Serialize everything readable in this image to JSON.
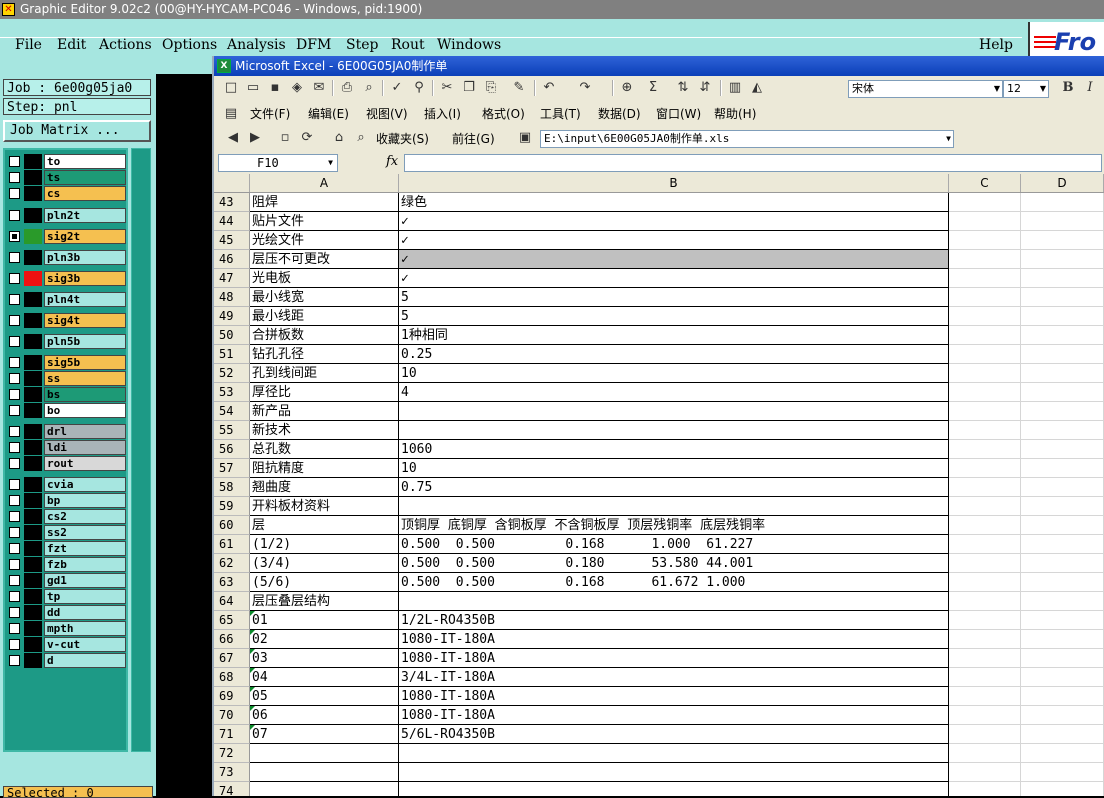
{
  "genesis": {
    "title": "Graphic Editor 9.02c2 (00@HY-HYCAM-PC046 - Windows, pid:1900)",
    "menu": [
      "File",
      "Edit",
      "Actions",
      "Options",
      "Analysis",
      "DFM",
      "Step",
      "Rout",
      "Windows"
    ],
    "help": "Help",
    "logo_text": "Fro",
    "job": "Job : 6e00g05ja0",
    "step": "Step: pnl",
    "job_matrix": "Job Matrix ...",
    "selected": "Selected : 0",
    "layers": [
      {
        "name": "to",
        "color": "#ffffff",
        "checked": false
      },
      {
        "name": "ts",
        "color": "#1d9a76",
        "checked": false
      },
      {
        "name": "cs",
        "color": "#f5c050",
        "checked": false
      },
      {
        "name": "pln2t",
        "color": "#a6e6e0",
        "checked": false
      },
      {
        "name": "sig2t",
        "color": "#f5c050",
        "checked": true,
        "swatch": "#2a9a2a"
      },
      {
        "name": "pln3b",
        "color": "#a6e6e0",
        "checked": false
      },
      {
        "name": "sig3b",
        "color": "#f5c050",
        "checked": false,
        "swatch": "#ee1111"
      },
      {
        "name": "pln4t",
        "color": "#a6e6e0",
        "checked": false
      },
      {
        "name": "sig4t",
        "color": "#f5c050",
        "checked": false
      },
      {
        "name": "pln5b",
        "color": "#a6e6e0",
        "checked": false
      },
      {
        "name": "sig5b",
        "color": "#f5c050",
        "checked": false
      },
      {
        "name": "ss",
        "color": "#f5c050",
        "checked": false
      },
      {
        "name": "bs",
        "color": "#1d9a76",
        "checked": false
      },
      {
        "name": "bo",
        "color": "#ffffff",
        "checked": false
      },
      {
        "name": "drl",
        "color": "#a9b4b8",
        "checked": false
      },
      {
        "name": "ldi",
        "color": "#a9b4b8",
        "checked": false
      },
      {
        "name": "rout",
        "color": "#d8d8d8",
        "checked": false
      },
      {
        "name": "cvia",
        "color": "#a6e6e0",
        "checked": false
      },
      {
        "name": "bp",
        "color": "#a6e6e0",
        "checked": false
      },
      {
        "name": "cs2",
        "color": "#a6e6e0",
        "checked": false
      },
      {
        "name": "ss2",
        "color": "#a6e6e0",
        "checked": false
      },
      {
        "name": "fzt",
        "color": "#a6e6e0",
        "checked": false
      },
      {
        "name": "fzb",
        "color": "#a6e6e0",
        "checked": false
      },
      {
        "name": "gd1",
        "color": "#a6e6e0",
        "checked": false
      },
      {
        "name": "tp",
        "color": "#a6e6e0",
        "checked": false
      },
      {
        "name": "dd",
        "color": "#a6e6e0",
        "checked": false
      },
      {
        "name": "mpth",
        "color": "#a6e6e0",
        "checked": false
      },
      {
        "name": "v-cut",
        "color": "#a6e6e0",
        "checked": false
      },
      {
        "name": "d",
        "color": "#a6e6e0",
        "checked": false
      }
    ]
  },
  "excel": {
    "title": "Microsoft Excel - 6E00G05JA0制作单",
    "font_name": "宋体",
    "font_size": "12",
    "menu": [
      "文件(F)",
      "编辑(E)",
      "视图(V)",
      "插入(I)",
      "格式(O)",
      "工具(T)",
      "数据(D)",
      "窗口(W)",
      "帮助(H)"
    ],
    "favorites": "收藏夹(S)",
    "goto": "前往(G)",
    "address": "E:\\input\\6E00G05JA0制作单.xls",
    "name_box": "F10",
    "fx": "fx",
    "columns": [
      "A",
      "B",
      "C",
      "D"
    ],
    "rows": [
      {
        "n": "43",
        "a": "阻焊",
        "b": "绿色"
      },
      {
        "n": "44",
        "a": "贴片文件",
        "b": "✓"
      },
      {
        "n": "45",
        "a": "光绘文件",
        "b": "✓"
      },
      {
        "n": "46",
        "a": "层压不可更改",
        "b": "✓",
        "hl": true
      },
      {
        "n": "47",
        "a": "光电板",
        "b": "✓"
      },
      {
        "n": "48",
        "a": "最小线宽",
        "b": "5"
      },
      {
        "n": "49",
        "a": "最小线距",
        "b": "5"
      },
      {
        "n": "50",
        "a": "合拼板数",
        "b": "1种相同"
      },
      {
        "n": "51",
        "a": "钻孔孔径",
        "b": "0.25"
      },
      {
        "n": "52",
        "a": "孔到线间距",
        "b": "10"
      },
      {
        "n": "53",
        "a": "厚径比",
        "b": "4"
      },
      {
        "n": "54",
        "a": "新产品",
        "b": ""
      },
      {
        "n": "55",
        "a": "新技术",
        "b": ""
      },
      {
        "n": "56",
        "a": "总孔数",
        "b": "1060"
      },
      {
        "n": "57",
        "a": "阻抗精度",
        "b": "10"
      },
      {
        "n": "58",
        "a": "翘曲度",
        "b": "0.75"
      },
      {
        "n": "59",
        "a": "开料板材资料",
        "b": ""
      },
      {
        "n": "60",
        "a": "层",
        "b": "顶铜厚 底铜厚 含铜板厚 不含铜板厚 顶层残铜率 底层残铜率"
      },
      {
        "n": "61",
        "a": "(1/2)",
        "b": "0.500  0.500         0.168      1.000  61.227"
      },
      {
        "n": "62",
        "a": "(3/4)",
        "b": "0.500  0.500         0.180      53.580 44.001"
      },
      {
        "n": "63",
        "a": "(5/6)",
        "b": "0.500  0.500         0.168      61.672 1.000"
      },
      {
        "n": "64",
        "a": "层压叠层结构",
        "b": ""
      },
      {
        "n": "65",
        "a": "01",
        "b": "1/2L-RO4350B",
        "tri": true
      },
      {
        "n": "66",
        "a": "02",
        "b": "1080-IT-180A",
        "tri": true
      },
      {
        "n": "67",
        "a": "03",
        "b": "1080-IT-180A",
        "tri": true
      },
      {
        "n": "68",
        "a": "04",
        "b": "3/4L-IT-180A",
        "tri": true
      },
      {
        "n": "69",
        "a": "05",
        "b": "1080-IT-180A",
        "tri": true
      },
      {
        "n": "70",
        "a": "06",
        "b": "1080-IT-180A",
        "tri": true
      },
      {
        "n": "71",
        "a": "07",
        "b": "5/6L-RO4350B",
        "tri": true
      },
      {
        "n": "72",
        "a": "",
        "b": "",
        "empty": true
      },
      {
        "n": "73",
        "a": "",
        "b": "",
        "empty": true
      },
      {
        "n": "74",
        "a": "",
        "b": "",
        "empty": true
      }
    ]
  }
}
